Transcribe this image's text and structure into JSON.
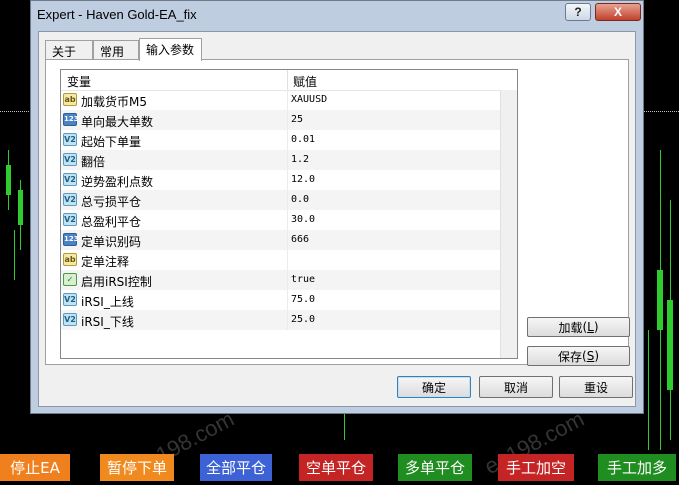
{
  "window": {
    "title": "Expert - Haven Gold-EA_fix",
    "help_label": "?",
    "close_label": "X"
  },
  "tabs": [
    {
      "label": "关于"
    },
    {
      "label": "常用"
    },
    {
      "label": "输入参数"
    }
  ],
  "grid": {
    "col_variable": "变量",
    "col_value": "赋值",
    "rows": [
      {
        "icon": "ab",
        "type": "string",
        "name": "加载货币M5",
        "value": "XAUUSD"
      },
      {
        "icon": "123",
        "type": "int",
        "name": "单向最大单数",
        "value": "25"
      },
      {
        "icon": "V2",
        "type": "double",
        "name": "起始下单量",
        "value": "0.01"
      },
      {
        "icon": "V2",
        "type": "double",
        "name": "翻倍",
        "value": "1.2"
      },
      {
        "icon": "V2",
        "type": "double",
        "name": "逆势盈利点数",
        "value": "12.0"
      },
      {
        "icon": "V2",
        "type": "double",
        "name": "总亏损平仓",
        "value": "0.0"
      },
      {
        "icon": "V2",
        "type": "double",
        "name": "总盈利平仓",
        "value": "30.0"
      },
      {
        "icon": "123",
        "type": "int",
        "name": "定单识别码",
        "value": "666"
      },
      {
        "icon": "ab",
        "type": "string",
        "name": "定单注释",
        "value": ""
      },
      {
        "icon": "✓",
        "type": "bool",
        "name": "启用iRSI控制",
        "value": "true"
      },
      {
        "icon": "V2",
        "type": "double",
        "name": "iRSI_上线",
        "value": "75.0"
      },
      {
        "icon": "V2",
        "type": "double",
        "name": "iRSI_下线",
        "value": "25.0"
      }
    ]
  },
  "side_buttons": {
    "load_label": "加载",
    "load_key": "L",
    "save_label": "保存",
    "save_key": "S"
  },
  "footer_buttons": {
    "ok": "确定",
    "cancel": "取消",
    "reset": "重设"
  },
  "action_bar": [
    {
      "label": "停止EA",
      "color": "#f0801e"
    },
    {
      "label": "暂停下单",
      "color": "#f08a1e"
    },
    {
      "label": "全部平仓",
      "color": "#3d62d6"
    },
    {
      "label": "空单平仓",
      "color": "#c42424"
    },
    {
      "label": "多单平仓",
      "color": "#1f8d1f"
    },
    {
      "label": "手工加空",
      "color": "#c42424"
    },
    {
      "label": "手工加多",
      "color": "#1f8d1f"
    }
  ],
  "watermark": "ea198.com"
}
